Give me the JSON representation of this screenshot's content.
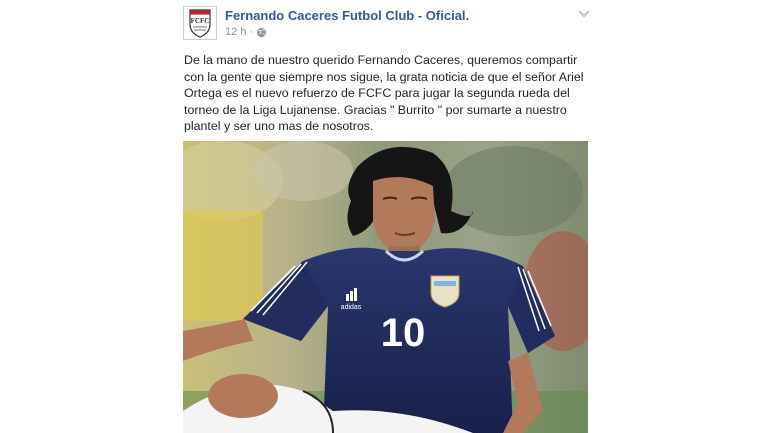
{
  "post": {
    "page_name": "Fernando Caceres Futbol Club - Oficial.",
    "timestamp": "12 h",
    "separator": "·",
    "privacy_icon": "globe-icon",
    "avatar_text": "FCFC",
    "text_lines": [
      "De la mano de nuestro querido Fernando Caceres, queremos compartir",
      "con la gente que siempre nos sigue, la grata noticia de que el señor Ariel",
      "Ortega es el nuevo refuerzo de FCFC para jugar la segunda rueda del",
      "torneo de la Liga Lujanense. Gracias \" Burrito \" por sumarte a nuestro",
      "plantel y ser uno mas de nosotros."
    ],
    "photo": {
      "jersey_number": "10",
      "kit_brand": "adidas"
    }
  },
  "colors": {
    "link": "#365899",
    "text": "#1d2129",
    "meta": "#90949c",
    "jersey": "#1f2a5c"
  }
}
